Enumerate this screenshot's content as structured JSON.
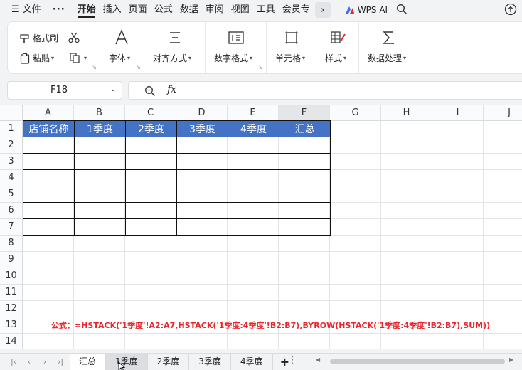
{
  "menu": {
    "file": "文件",
    "more": "···",
    "tabs": [
      "开始",
      "插入",
      "页面",
      "公式",
      "数据",
      "审阅",
      "视图",
      "工具",
      "会员专"
    ],
    "active_tab": 0,
    "wps_ai": "WPS AI"
  },
  "ribbon": {
    "format_painter": "格式刷",
    "paste": "粘贴",
    "font": "字体",
    "align": "对齐方式",
    "number_format": "数字格式",
    "cell": "单元格",
    "style": "样式",
    "data_process": "数据处理"
  },
  "formula_bar": {
    "name_box": "F18",
    "fx": "fx"
  },
  "sheet": {
    "columns": [
      "A",
      "B",
      "C",
      "D",
      "E",
      "F",
      "G",
      "H",
      "I",
      "J"
    ],
    "selected_column": "F",
    "rows": [
      "1",
      "2",
      "3",
      "4",
      "5",
      "6",
      "7",
      "8",
      "9",
      "10",
      "11",
      "12",
      "13",
      "14"
    ],
    "table_header": [
      "店铺名称",
      "1季度",
      "2季度",
      "3季度",
      "4季度",
      "汇总"
    ],
    "formula_note": "公式：=HSTACK('1季度'!A2:A7,HSTACK('1季度:4季度'!B2:B7),BYROW(HSTACK('1季度:4季度'!B2:B7),SUM))"
  },
  "sheet_tabs": {
    "tabs": [
      "汇总",
      "1季度",
      "2季度",
      "3季度",
      "4季度"
    ],
    "active": 0,
    "add": "+",
    "more": "⋮"
  },
  "colors": {
    "header_fill": "#4472c4",
    "header_text": "#ffffff",
    "formula_text": "#e8262b"
  }
}
